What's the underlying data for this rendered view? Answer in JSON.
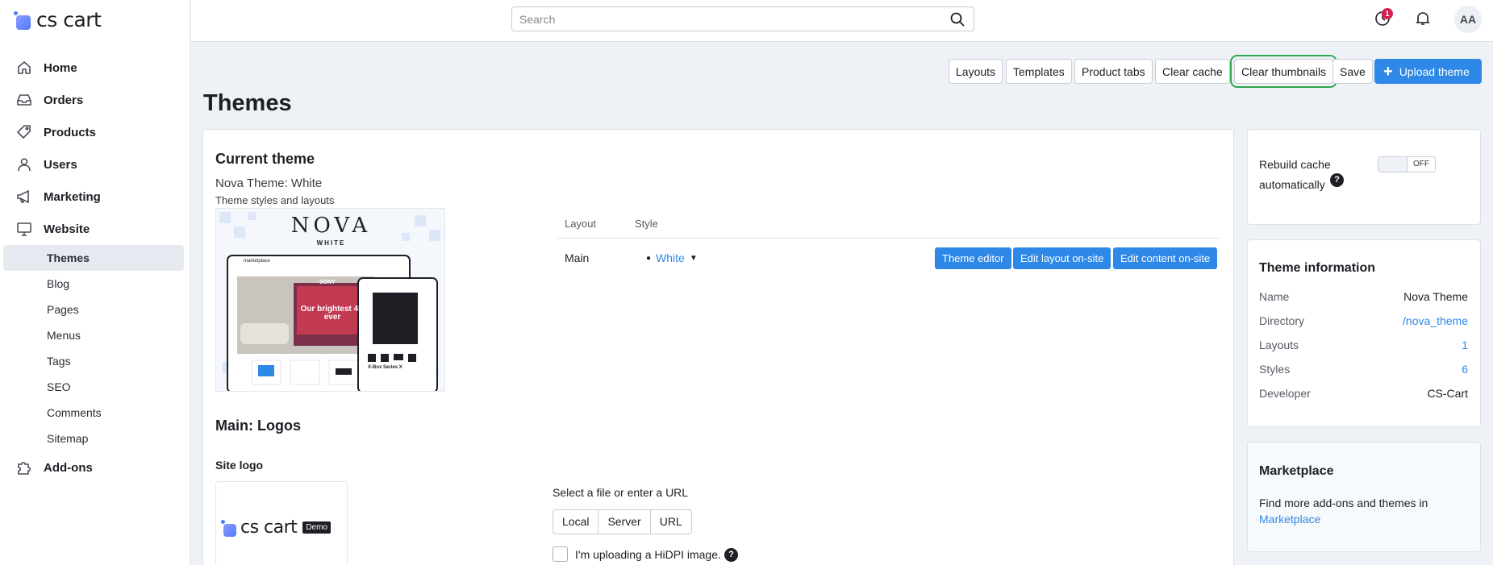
{
  "app": {
    "logo_text": "cs cart"
  },
  "sidebar": {
    "items": [
      {
        "label": "Home"
      },
      {
        "label": "Orders"
      },
      {
        "label": "Products"
      },
      {
        "label": "Users"
      },
      {
        "label": "Marketing"
      },
      {
        "label": "Website"
      }
    ],
    "website_sub": [
      "Themes",
      "Blog",
      "Pages",
      "Menus",
      "Tags",
      "SEO",
      "Comments",
      "Sitemap"
    ],
    "addons_label": "Add-ons",
    "active_sub": "Themes"
  },
  "topbar": {
    "search_placeholder": "Search",
    "notification_count": "1",
    "avatar_initials": "AA"
  },
  "toolbar": {
    "layouts": "Layouts",
    "templates": "Templates",
    "product_tabs": "Product tabs",
    "clear_cache": "Clear cache",
    "clear_thumbnails": "Clear thumbnails",
    "save": "Save",
    "upload_theme": "Upload theme"
  },
  "page": {
    "title": "Themes"
  },
  "current_theme": {
    "heading": "Current theme",
    "name": "Nova Theme: White",
    "subtitle": "Theme styles and layouts",
    "preview": {
      "brand": "NOVA",
      "brand_sub": "WHITE",
      "store_name": "marketplace",
      "banner_brand": "SONY",
      "banner_text": "Our brightest 4K ever",
      "product_name": "X-Box Series X"
    },
    "table": {
      "col_layout": "Layout",
      "col_style": "Style",
      "layout_value": "Main",
      "style_value": "White"
    },
    "buttons": {
      "theme_editor": "Theme editor",
      "edit_layout": "Edit layout on-site",
      "edit_content": "Edit content on-site"
    }
  },
  "logos": {
    "heading": "Main: Logos",
    "site_logo_label": "Site logo",
    "logo_text": "cs cart",
    "demo_badge": "Demo",
    "file_prompt": "Select a file or enter a URL",
    "sources": [
      "Local",
      "Server",
      "URL"
    ],
    "hidpi_label": "I'm uploading a HiDPI image."
  },
  "rebuild": {
    "label_line1": "Rebuild cache",
    "label_line2": "automatically",
    "toggle_state": "OFF"
  },
  "theme_info": {
    "heading": "Theme information",
    "rows": [
      {
        "key": "Name",
        "value": "Nova Theme"
      },
      {
        "key": "Directory",
        "value": "/nova_theme"
      },
      {
        "key": "Layouts",
        "value": "1"
      },
      {
        "key": "Styles",
        "value": "6"
      },
      {
        "key": "Developer",
        "value": "CS-Cart"
      }
    ]
  },
  "marketplace": {
    "heading": "Marketplace",
    "text": "Find more add-ons and themes in",
    "link": "Marketplace"
  }
}
